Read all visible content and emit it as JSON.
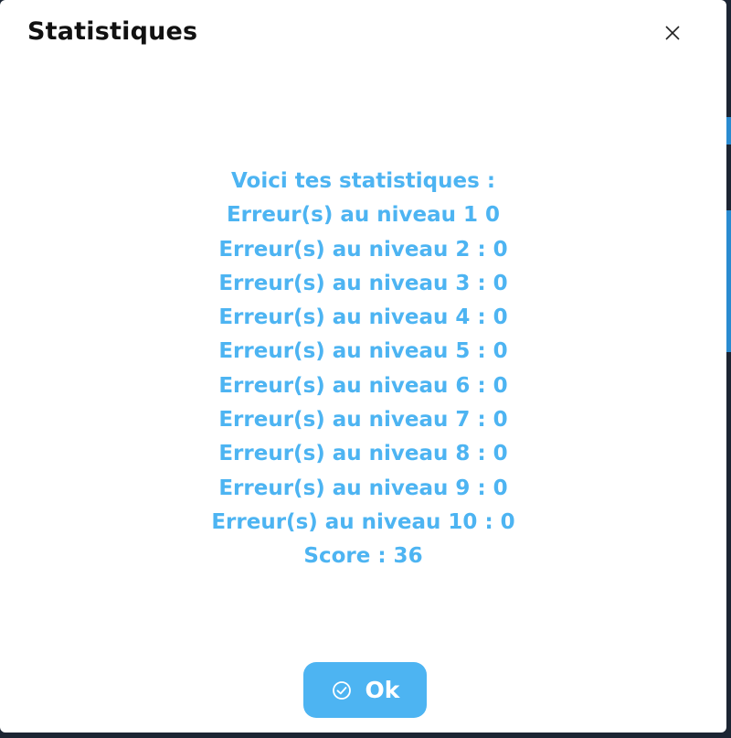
{
  "dialog": {
    "title": "Statistiques",
    "close_icon": "close-icon"
  },
  "stats": {
    "heading": "Voici tes statistiques :",
    "lines": [
      "Erreur(s) au niveau 1 0",
      "Erreur(s) au niveau 2 : 0",
      "Erreur(s) au niveau 3 : 0",
      "Erreur(s) au niveau 4 : 0",
      "Erreur(s) au niveau 5 : 0",
      "Erreur(s) au niveau 6 : 0",
      "Erreur(s) au niveau 7 : 0",
      "Erreur(s) au niveau 8 : 0",
      "Erreur(s) au niveau 9 : 0",
      "Erreur(s) au niveau 10 : 0"
    ],
    "score": "Score : 36"
  },
  "ok_button": {
    "label": "Ok",
    "icon": "check-circle-icon"
  },
  "colors": {
    "accent": "#4db4f2",
    "title": "#111111",
    "background": "#ffffff"
  }
}
